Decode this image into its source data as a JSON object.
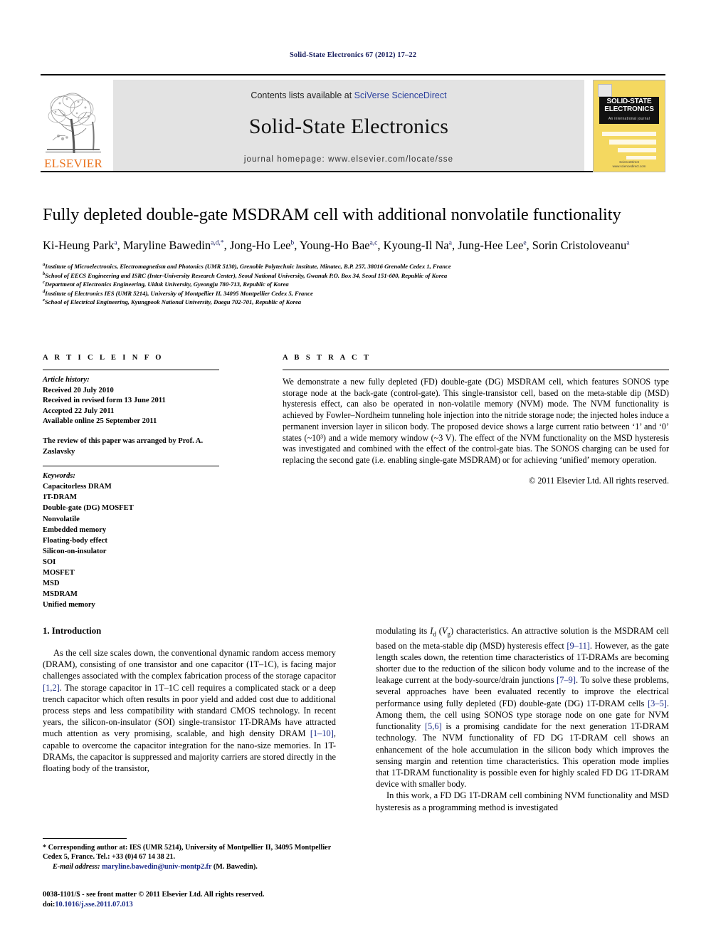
{
  "running_head": "Solid-State Electronics 67 (2012) 17–22",
  "masthead": {
    "contents_prefix": "Contents lists available at ",
    "sciencedirect": "SciVerse ScienceDirect",
    "journal_name": "Solid-State Electronics",
    "homepage": "journal homepage: www.elsevier.com/locate/sse",
    "publisher": "ELSEVIER",
    "cover": {
      "title_line1": "SOLID-STATE",
      "title_line2": "ELECTRONICS",
      "subtitle": "An international journal",
      "footer_line1": "ScienceDirect",
      "footer_line2": "www.sciencedirect.com"
    },
    "accent_orange": "#E9711C",
    "link_blue": "#2a3f9d",
    "band_gray": "#e3e3e3"
  },
  "title": "Fully depleted double-gate MSDRAM cell with additional nonvolatile functionality",
  "authors": [
    {
      "name": "Ki-Heung Park",
      "marks": "a",
      "sep": ", "
    },
    {
      "name": "Maryline Bawedin",
      "marks": "a,d,*",
      "sep": ", "
    },
    {
      "name": "Jong-Ho Lee",
      "marks": "b",
      "sep": ", "
    },
    {
      "name": "Young-Ho Bae",
      "marks": "a,c",
      "sep": ", "
    },
    {
      "name": "Kyoung-Il Na",
      "marks": "a",
      "sep": ", "
    },
    {
      "name": "Jung-Hee Lee",
      "marks": "e",
      "sep": ", "
    },
    {
      "name": "Sorin Cristoloveanu",
      "marks": "a",
      "sep": ""
    }
  ],
  "affiliations": [
    {
      "mark": "a",
      "text": "Institute of Microelectronics, Electromagnetism and Photonics (UMR 5130), Grenoble Polytechnic Institute, Minatec, B.P. 257, 38016 Grenoble Cedex 1, France"
    },
    {
      "mark": "b",
      "text": "School of EECS Engineering and ISRC (Inter-University Research Center), Seoul National University, Gwanak P.O. Box 34, Seoul 151-600, Republic of Korea"
    },
    {
      "mark": "c",
      "text": "Department of Electronics Engineering, Uiduk University, Gyeongju 780-713, Republic of Korea"
    },
    {
      "mark": "d",
      "text": "Institute of Electronics IES (UMR 5214), University of Montpellier II, 34095 Montpellier Cedex 5, France"
    },
    {
      "mark": "e",
      "text": "School of Electrical Engineering, Kyungpook National University, Daegu 702-701, Republic of Korea"
    }
  ],
  "article_info": {
    "label": "A R T I C L E   I N F O",
    "history_heading": "Article history:",
    "history": [
      "Received 20 July 2010",
      "Received in revised form 13 June 2011",
      "Accepted 22 July 2011",
      "Available online 25 September 2011"
    ],
    "review_note": "The review of this paper was arranged by Prof. A. Zaslavsky",
    "keywords_heading": "Keywords:",
    "keywords": [
      "Capacitorless DRAM",
      "1T-DRAM",
      "Double-gate (DG) MOSFET",
      "Nonvolatile",
      "Embedded memory",
      "Floating-body effect",
      "Silicon-on-insulator",
      "SOI",
      "MOSFET",
      "MSD",
      "MSDRAM",
      "Unified memory"
    ]
  },
  "abstract": {
    "label": "A B S T R A C T",
    "text": "We demonstrate a new fully depleted (FD) double-gate (DG) MSDRAM cell, which features SONOS type storage node at the back-gate (control-gate). This single-transistor cell, based on the meta-stable dip (MSD) hysteresis effect, can also be operated in non-volatile memory (NVM) mode. The NVM functionality is achieved by Fowler–Nordheim tunneling hole injection into the nitride storage node; the injected holes induce a permanent inversion layer in silicon body. The proposed device shows a large current ratio between ‘1’ and ‘0’ states (~10³) and a wide memory window (~3 V). The effect of the NVM functionality on the MSD hysteresis was investigated and combined with the effect of the control-gate bias. The SONOS charging can be used for replacing the second gate (i.e. enabling single-gate MSDRAM) or for achieving ‘unified’ memory operation.",
    "copyright": "© 2011 Elsevier Ltd. All rights reserved."
  },
  "introduction": {
    "heading": "1. Introduction",
    "para1_a": "As the cell size scales down, the conventional dynamic random access memory (DRAM), consisting of one transistor and one capacitor (1T–1C), is facing major challenges associated with the complex fabrication process of the storage capacitor ",
    "ref1": "[1,2]",
    "para1_b": ". The storage capacitor in 1T–1C cell requires a complicated stack or a deep trench capacitor which often results in poor yield and added cost due to additional process steps and less compatibility with standard CMOS technology. In recent years, the silicon-on-insulator (SOI) single-transistor 1T-DRAMs have attracted much attention as very promising, scalable, and high density DRAM ",
    "ref2": "[1–10]",
    "para1_c": ", capable to overcome the capacitor integration for the nano-size memories. In 1T-DRAMs, the capacitor is suppressed and majority carriers are stored directly in the floating body of the transistor,",
    "para2_a": "modulating its ",
    "para2_id": "I",
    "para2_id_sub": "d",
    "para2_vg_open": " (",
    "para2_vg": "V",
    "para2_vg_sub": "g",
    "para2_b": ") characteristics. An attractive solution is the MSDRAM cell based on the meta-stable dip (MSD) hysteresis effect ",
    "ref3": "[9–11]",
    "para2_c": ". However, as the gate length scales down, the retention time characteristics of 1T-DRAMs are becoming shorter due to the reduction of the silicon body volume and to the increase of the leakage current at the body-source/drain junctions ",
    "ref4": "[7–9]",
    "para2_d": ". To solve these problems, several approaches have been evaluated recently to improve the electrical performance using fully depleted (FD) double-gate (DG) 1T-DRAM cells ",
    "ref5": "[3–5]",
    "para2_e": ". Among them, the cell using SONOS type storage node on one gate for NVM functionality ",
    "ref6": "[5,6]",
    "para2_f": " is a promising candidate for the next generation 1T-DRAM technology. The NVM functionality of FD DG 1T-DRAM cell shows an enhancement of the hole accumulation in the silicon body which improves the sensing margin and retention time characteristics. This operation mode implies that 1T-DRAM functionality is possible even for highly scaled FD DG 1T-DRAM device with smaller body.",
    "para3": "In this work, a FD DG 1T-DRAM cell combining NVM functionality and MSD hysteresis as a programming method is investigated"
  },
  "footnotes": {
    "corresponding_mark": "*",
    "corresponding": " Corresponding author at: IES (UMR 5214), University of Montpellier II, 34095 Montpellier Cedex 5, France. Tel.: +33 (0)4 67 14 38 21.",
    "email_label": "E-mail address:",
    "email": "maryline.bawedin@univ-montp2.fr",
    "email_suffix": " (M. Bawedin).",
    "issn_line": "0038-1101/$ - see front matter © 2011 Elsevier Ltd. All rights reserved.",
    "doi_label": "doi:",
    "doi": "10.1016/j.sse.2011.07.013"
  }
}
